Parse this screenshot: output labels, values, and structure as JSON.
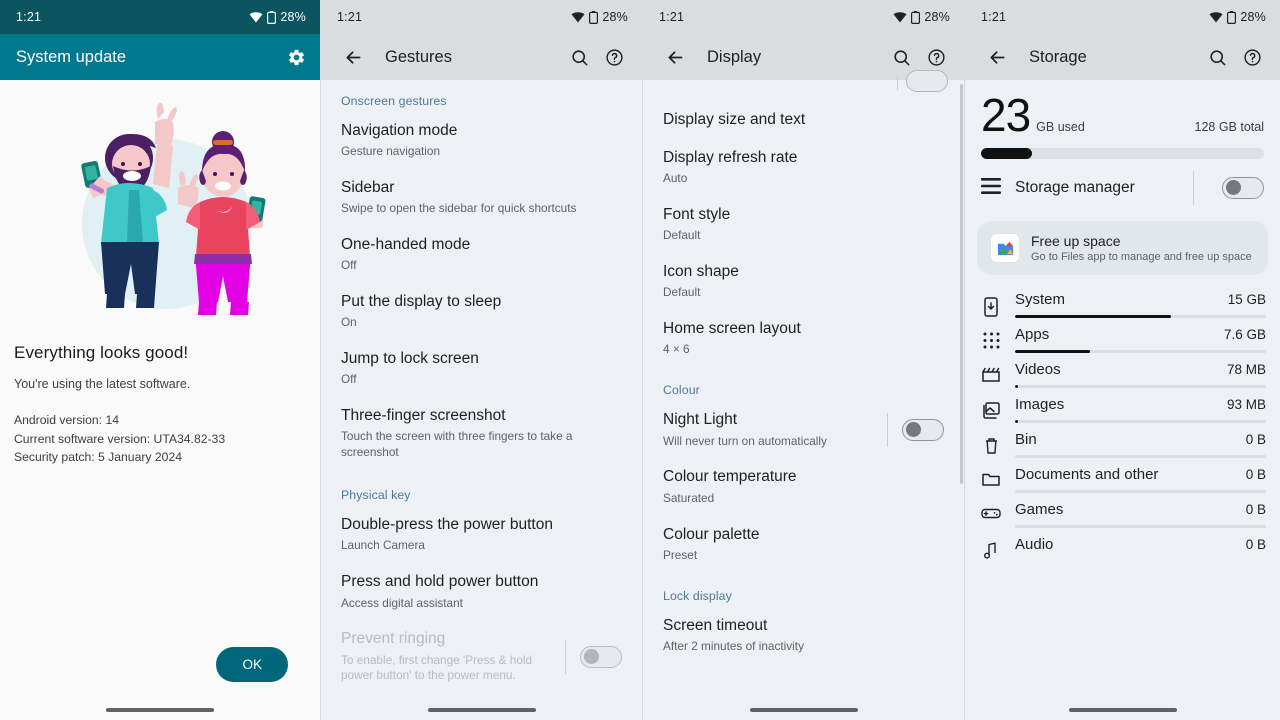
{
  "status_bar": {
    "time": "1:21",
    "battery": "28%",
    "wifi_icon": "wifi-icon",
    "battery_icon": "battery-icon"
  },
  "panel1": {
    "app_bar": {
      "title": "System update",
      "settings_icon": "gear-icon"
    },
    "illustration": "two-people-celebrating-illustration",
    "heading": "Everything looks good!",
    "subtitle": "You're using the latest software.",
    "meta": [
      "Android version: 14",
      "Current software version: UTA34.82-33",
      "Security patch: 5 January 2024"
    ],
    "ok_button": "OK",
    "accent_color": "#00667a",
    "statusbar_color": "#0c5460",
    "appbar_color": "#00798f"
  },
  "panel2": {
    "app_bar": {
      "back_icon": "back-arrow-icon",
      "title": "Gestures",
      "search_icon": "search-icon",
      "help_icon": "help-icon"
    },
    "sections": [
      {
        "label": "Onscreen gestures",
        "items": [
          {
            "title": "Navigation mode",
            "subtitle": "Gesture navigation"
          },
          {
            "title": "Sidebar",
            "subtitle": "Swipe to open the sidebar for quick shortcuts"
          },
          {
            "title": "One-handed mode",
            "subtitle": "Off"
          },
          {
            "title": "Put the display to sleep",
            "subtitle": "On"
          },
          {
            "title": "Jump to lock screen",
            "subtitle": "Off"
          },
          {
            "title": "Three-finger screenshot",
            "subtitle": "Touch the screen with three fingers to take a screenshot"
          }
        ]
      },
      {
        "label": "Physical key",
        "items": [
          {
            "title": "Double-press the power button",
            "subtitle": "Launch Camera"
          },
          {
            "title": "Press and hold power button",
            "subtitle": "Access digital assistant"
          },
          {
            "title": "Prevent ringing",
            "subtitle": "To enable, first change 'Press & hold power button' to the power menu.",
            "disabled": true,
            "toggle": "off"
          }
        ]
      }
    ]
  },
  "panel3": {
    "app_bar": {
      "back_icon": "back-arrow-icon",
      "title": "Display",
      "search_icon": "search-icon",
      "help_icon": "help-icon"
    },
    "items": [
      {
        "title": "Display size and text",
        "subtitle": ""
      },
      {
        "title": "Display refresh rate",
        "subtitle": "Auto"
      },
      {
        "title": "Font style",
        "subtitle": "Default"
      },
      {
        "title": "Icon shape",
        "subtitle": "Default"
      },
      {
        "title": "Home screen layout",
        "subtitle": "4 × 6"
      }
    ],
    "section_colour": "Colour",
    "colour_items": [
      {
        "title": "Night Light",
        "subtitle": "Will never turn on automatically",
        "toggle": "off"
      },
      {
        "title": "Colour temperature",
        "subtitle": "Saturated"
      },
      {
        "title": "Colour palette",
        "subtitle": "Preset"
      }
    ],
    "section_lock": "Lock display",
    "lock_items": [
      {
        "title": "Screen timeout",
        "subtitle": "After 2 minutes of inactivity"
      }
    ]
  },
  "panel4": {
    "app_bar": {
      "back_icon": "back-arrow-icon",
      "title": "Storage",
      "search_icon": "search-icon",
      "help_icon": "help-icon"
    },
    "used_number": "23",
    "used_unit": "GB used",
    "total": "128 GB total",
    "used_percent": 18,
    "storage_manager": {
      "label": "Storage manager",
      "icon": "list-icon",
      "toggle": "off"
    },
    "free_up": {
      "title": "Free up space",
      "subtitle": "Go to Files app to manage and free up space",
      "icon": "files-app-icon"
    },
    "categories": [
      {
        "icon": "system-phone-icon",
        "name": "System",
        "size": "15 GB",
        "percent": 62
      },
      {
        "icon": "apps-grid-icon",
        "name": "Apps",
        "size": "7.6 GB",
        "percent": 30
      },
      {
        "icon": "videos-clapper-icon",
        "name": "Videos",
        "size": "78 MB",
        "percent": 1
      },
      {
        "icon": "images-photo-icon",
        "name": "Images",
        "size": "93 MB",
        "percent": 1
      },
      {
        "icon": "bin-trash-icon",
        "name": "Bin",
        "size": "0 B",
        "percent": 0
      },
      {
        "icon": "documents-folder-icon",
        "name": "Documents and other",
        "size": "0 B",
        "percent": 0
      },
      {
        "icon": "games-controller-icon",
        "name": "Games",
        "size": "0 B",
        "percent": 0
      },
      {
        "icon": "audio-note-icon",
        "name": "Audio",
        "size": "0 B",
        "percent": 0
      }
    ]
  }
}
